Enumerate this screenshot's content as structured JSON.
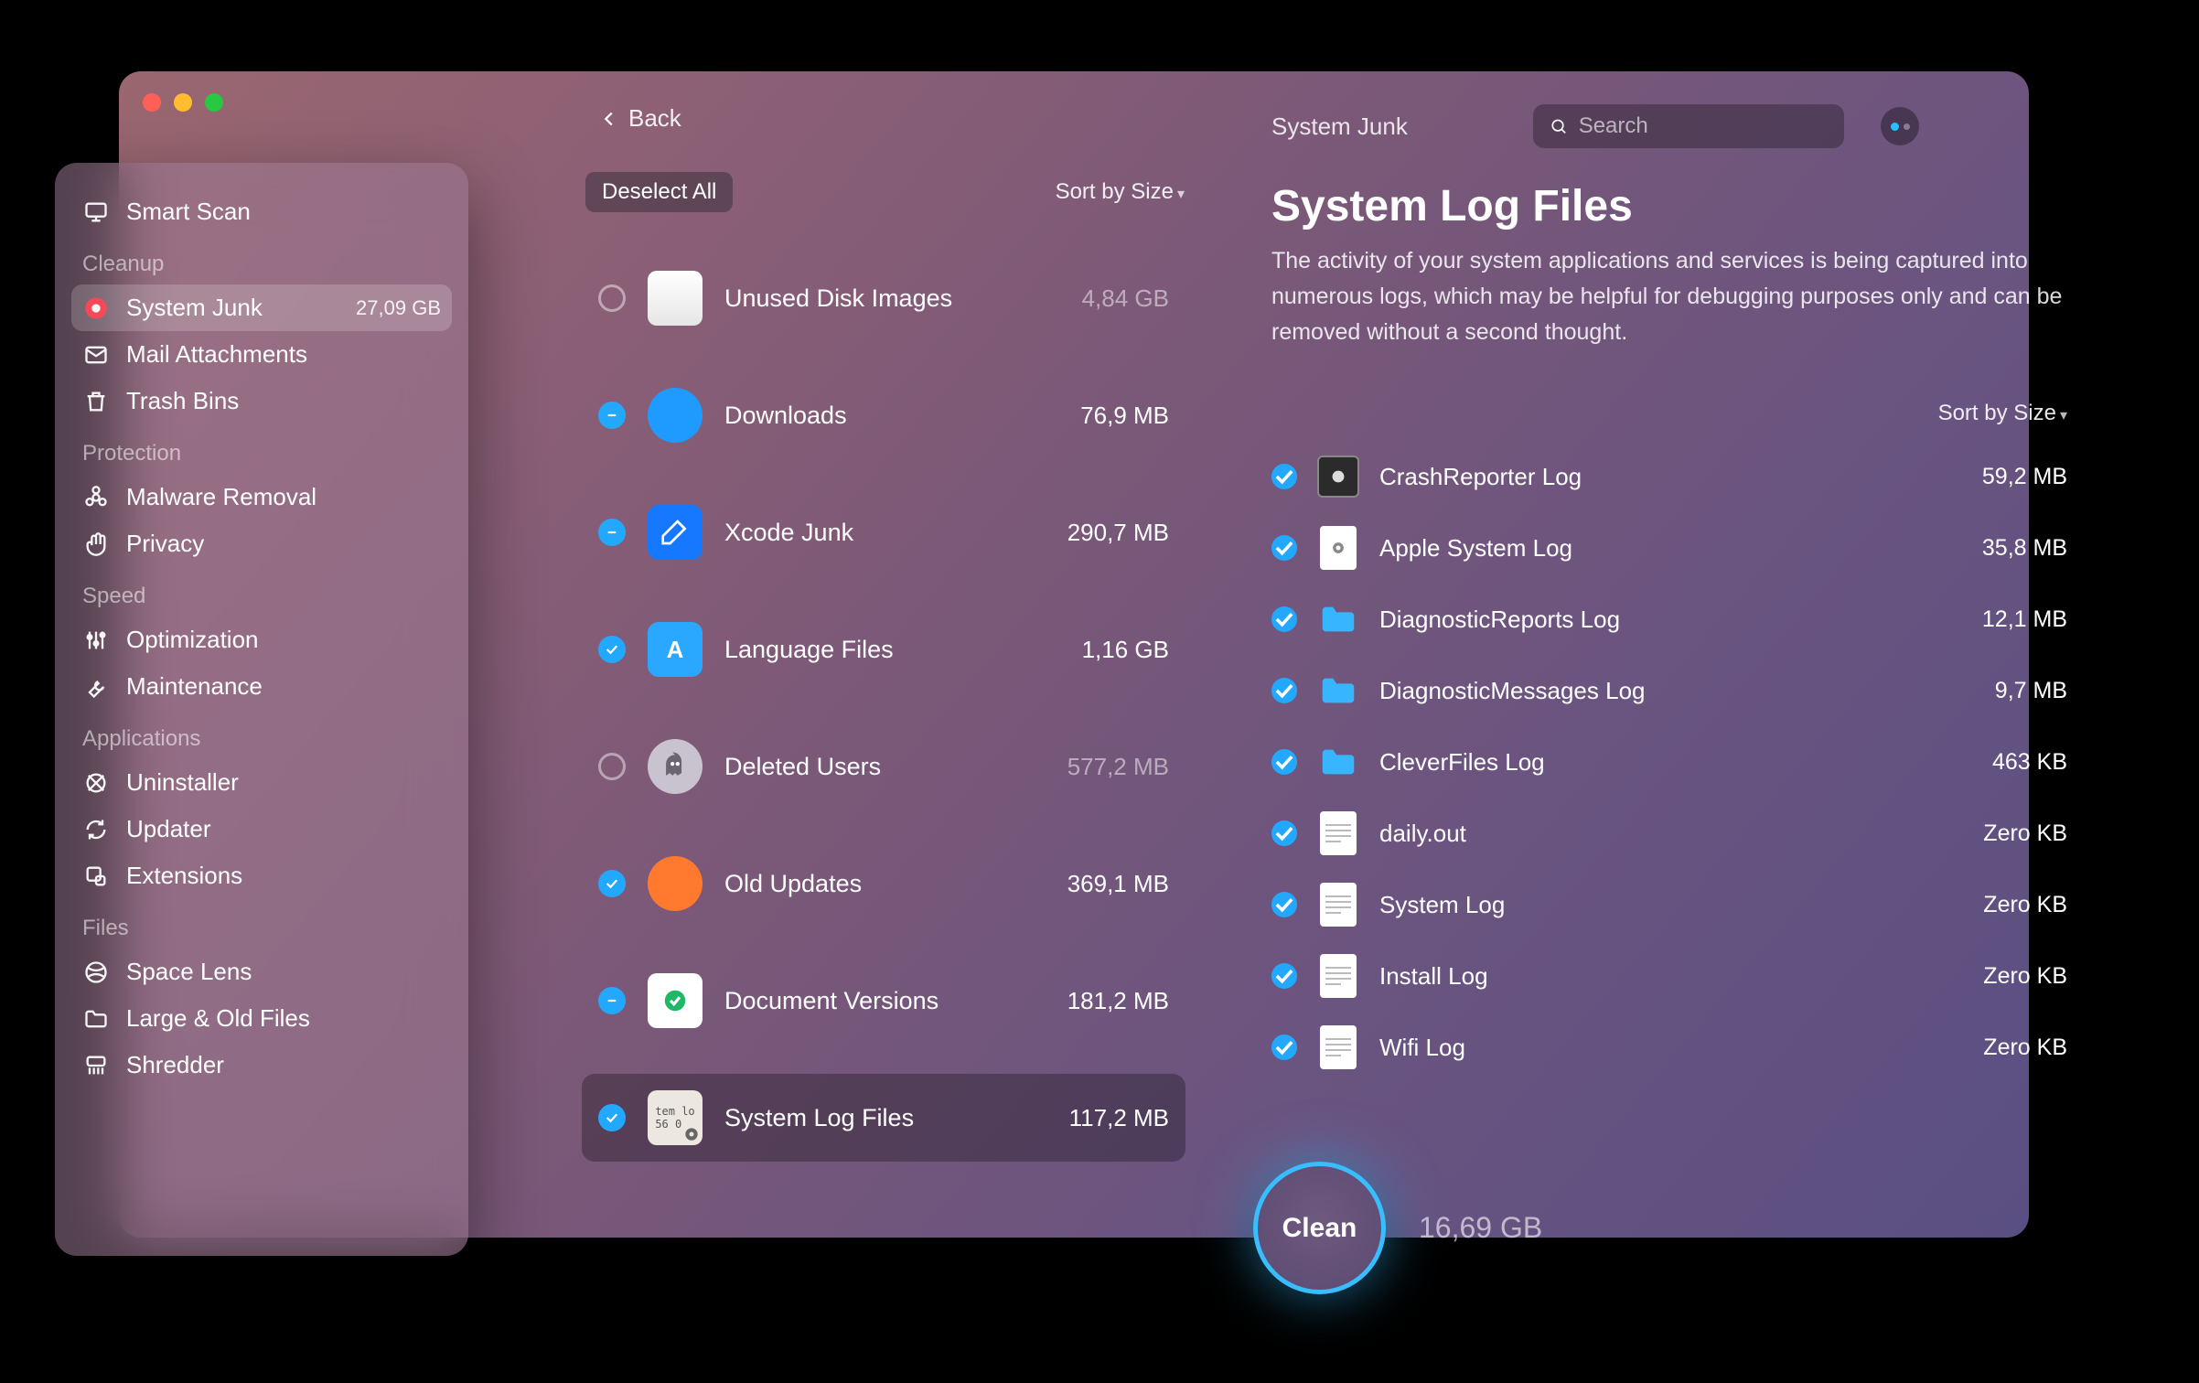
{
  "window": {
    "back_label": "Back"
  },
  "sidebar": {
    "smart_scan": "Smart Scan",
    "sections": {
      "cleanup": "Cleanup",
      "protection": "Protection",
      "speed": "Speed",
      "applications": "Applications",
      "files": "Files"
    },
    "items": {
      "system_junk": {
        "label": "System Junk",
        "badge": "27,09 GB"
      },
      "mail_attachments": {
        "label": "Mail Attachments"
      },
      "trash_bins": {
        "label": "Trash Bins"
      },
      "malware_removal": {
        "label": "Malware Removal"
      },
      "privacy": {
        "label": "Privacy"
      },
      "optimization": {
        "label": "Optimization"
      },
      "maintenance": {
        "label": "Maintenance"
      },
      "uninstaller": {
        "label": "Uninstaller"
      },
      "updater": {
        "label": "Updater"
      },
      "extensions": {
        "label": "Extensions"
      },
      "space_lens": {
        "label": "Space Lens"
      },
      "large_old_files": {
        "label": "Large & Old Files"
      },
      "shredder": {
        "label": "Shredder"
      }
    }
  },
  "categories": {
    "deselect_label": "Deselect All",
    "sort_label": "Sort by Size",
    "items": [
      {
        "key": "unused_disk_images",
        "label": "Unused Disk Images",
        "size": "4,84 GB",
        "check": "empty",
        "dim": true,
        "icon": "disk"
      },
      {
        "key": "downloads",
        "label": "Downloads",
        "size": "76,9 MB",
        "check": "partial",
        "dim": false,
        "icon": "download"
      },
      {
        "key": "xcode_junk",
        "label": "Xcode Junk",
        "size": "290,7 MB",
        "check": "partial",
        "dim": false,
        "icon": "xcode"
      },
      {
        "key": "language_files",
        "label": "Language Files",
        "size": "1,16 GB",
        "check": "full",
        "dim": false,
        "icon": "flag"
      },
      {
        "key": "deleted_users",
        "label": "Deleted Users",
        "size": "577,2 MB",
        "check": "empty",
        "dim": true,
        "icon": "ghost"
      },
      {
        "key": "old_updates",
        "label": "Old Updates",
        "size": "369,1 MB",
        "check": "full",
        "dim": false,
        "icon": "updates"
      },
      {
        "key": "document_versions",
        "label": "Document Versions",
        "size": "181,2 MB",
        "check": "partial",
        "dim": false,
        "icon": "versions"
      },
      {
        "key": "system_log_files",
        "label": "System Log Files",
        "size": "117,2 MB",
        "check": "full",
        "dim": false,
        "icon": "logs",
        "selected": true
      }
    ]
  },
  "detail": {
    "breadcrumb": "System Junk",
    "title": "System Log Files",
    "description": "The activity of your system applications and services is being captured into numerous logs, which may be helpful for debugging purposes only and can be removed without a second thought.",
    "sort_label": "Sort by Size",
    "search_placeholder": "Search",
    "logs": [
      {
        "label": "CrashReporter Log",
        "size": "59,2 MB",
        "icon": "plist"
      },
      {
        "label": "Apple System Log",
        "size": "35,8 MB",
        "icon": "gearfile"
      },
      {
        "label": "DiagnosticReports Log",
        "size": "12,1 MB",
        "icon": "folder"
      },
      {
        "label": "DiagnosticMessages Log",
        "size": "9,7 MB",
        "icon": "folder"
      },
      {
        "label": "CleverFiles Log",
        "size": "463 KB",
        "icon": "folder"
      },
      {
        "label": "daily.out",
        "size": "Zero KB",
        "icon": "textfile"
      },
      {
        "label": "System Log",
        "size": "Zero KB",
        "icon": "textfile"
      },
      {
        "label": "Install Log",
        "size": "Zero KB",
        "icon": "textfile"
      },
      {
        "label": "Wifi Log",
        "size": "Zero KB",
        "icon": "textfile"
      }
    ]
  },
  "clean": {
    "button_label": "Clean",
    "total": "16,69 GB"
  }
}
